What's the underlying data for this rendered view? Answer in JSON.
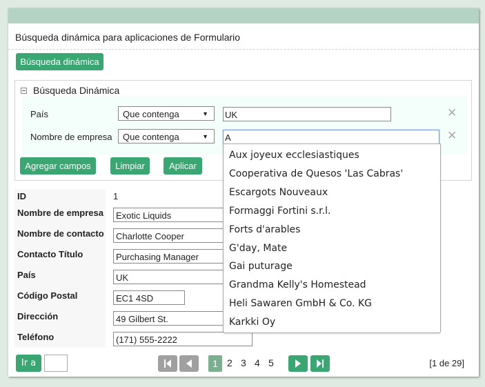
{
  "page": {
    "title": "Búsqueda dinámica para aplicaciones de Formulario",
    "dynamic_search_button": "Búsqueda dinámica"
  },
  "search_panel": {
    "header": "Búsqueda Dinámica",
    "filters": [
      {
        "label": "País",
        "operator": "Que contenga",
        "value": "UK"
      },
      {
        "label": "Nombre de empresa",
        "operator": "Que contenga",
        "value": "A"
      }
    ],
    "buttons": {
      "add_fields": "Agregar campos",
      "clear": "Limpiar",
      "apply": "Aplicar"
    }
  },
  "autocomplete": [
    "Aux joyeux ecclesiastiques",
    "Cooperativa de Quesos 'Las Cabras'",
    "Escargots Nouveaux",
    "Formaggi Fortini s.r.l.",
    "Forts d'arables",
    "G'day, Mate",
    "Gai puturage",
    "Grandma Kelly's Homestead",
    "Heli Sawaren GmbH & Co. KG",
    "Karkki Oy"
  ],
  "record": {
    "id_label": "ID",
    "id_value": "1",
    "fields": [
      {
        "label": "Nombre de empresa",
        "value": "Exotic Liquids"
      },
      {
        "label": "Nombre de contacto",
        "value": "Charlotte Cooper"
      },
      {
        "label": "Contacto Título",
        "value": "Purchasing Manager"
      },
      {
        "label": "País",
        "value": "UK"
      },
      {
        "label": "Código Postal",
        "value": "EC1 4SD"
      },
      {
        "label": "Dirección",
        "value": "49 Gilbert St."
      },
      {
        "label": "Teléfono",
        "value": "(171) 555-2222"
      }
    ]
  },
  "pager": {
    "goto_label": "Ir a",
    "goto_value": "",
    "pages": [
      "1",
      "2",
      "3",
      "4",
      "5"
    ],
    "current_page": "1",
    "count": "[1 de 29]"
  },
  "colors": {
    "accent": "#3aa672",
    "header_bar": "#b5d3c4",
    "disabled": "#a0a0a0"
  }
}
